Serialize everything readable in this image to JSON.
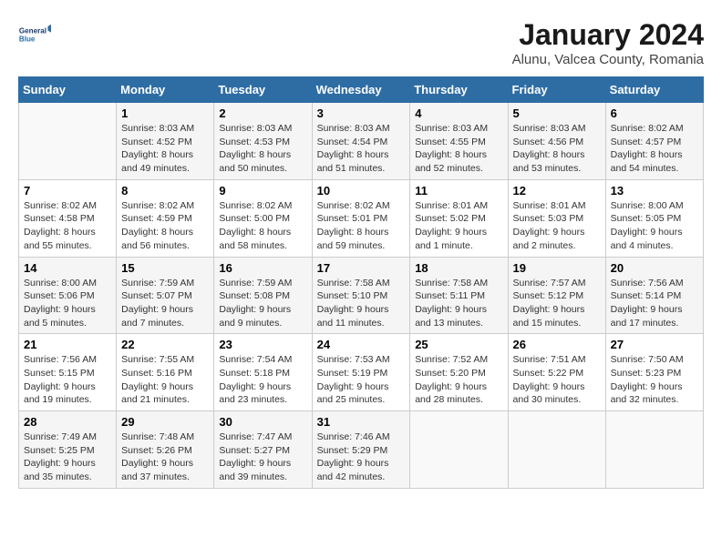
{
  "header": {
    "logo_line1": "General",
    "logo_line2": "Blue",
    "month": "January 2024",
    "location": "Alunu, Valcea County, Romania"
  },
  "days_of_week": [
    "Sunday",
    "Monday",
    "Tuesday",
    "Wednesday",
    "Thursday",
    "Friday",
    "Saturday"
  ],
  "weeks": [
    [
      {
        "day": "",
        "sunrise": "",
        "sunset": "",
        "daylight": ""
      },
      {
        "day": "1",
        "sunrise": "Sunrise: 8:03 AM",
        "sunset": "Sunset: 4:52 PM",
        "daylight": "Daylight: 8 hours and 49 minutes."
      },
      {
        "day": "2",
        "sunrise": "Sunrise: 8:03 AM",
        "sunset": "Sunset: 4:53 PM",
        "daylight": "Daylight: 8 hours and 50 minutes."
      },
      {
        "day": "3",
        "sunrise": "Sunrise: 8:03 AM",
        "sunset": "Sunset: 4:54 PM",
        "daylight": "Daylight: 8 hours and 51 minutes."
      },
      {
        "day": "4",
        "sunrise": "Sunrise: 8:03 AM",
        "sunset": "Sunset: 4:55 PM",
        "daylight": "Daylight: 8 hours and 52 minutes."
      },
      {
        "day": "5",
        "sunrise": "Sunrise: 8:03 AM",
        "sunset": "Sunset: 4:56 PM",
        "daylight": "Daylight: 8 hours and 53 minutes."
      },
      {
        "day": "6",
        "sunrise": "Sunrise: 8:02 AM",
        "sunset": "Sunset: 4:57 PM",
        "daylight": "Daylight: 8 hours and 54 minutes."
      }
    ],
    [
      {
        "day": "7",
        "sunrise": "Sunrise: 8:02 AM",
        "sunset": "Sunset: 4:58 PM",
        "daylight": "Daylight: 8 hours and 55 minutes."
      },
      {
        "day": "8",
        "sunrise": "Sunrise: 8:02 AM",
        "sunset": "Sunset: 4:59 PM",
        "daylight": "Daylight: 8 hours and 56 minutes."
      },
      {
        "day": "9",
        "sunrise": "Sunrise: 8:02 AM",
        "sunset": "Sunset: 5:00 PM",
        "daylight": "Daylight: 8 hours and 58 minutes."
      },
      {
        "day": "10",
        "sunrise": "Sunrise: 8:02 AM",
        "sunset": "Sunset: 5:01 PM",
        "daylight": "Daylight: 8 hours and 59 minutes."
      },
      {
        "day": "11",
        "sunrise": "Sunrise: 8:01 AM",
        "sunset": "Sunset: 5:02 PM",
        "daylight": "Daylight: 9 hours and 1 minute."
      },
      {
        "day": "12",
        "sunrise": "Sunrise: 8:01 AM",
        "sunset": "Sunset: 5:03 PM",
        "daylight": "Daylight: 9 hours and 2 minutes."
      },
      {
        "day": "13",
        "sunrise": "Sunrise: 8:00 AM",
        "sunset": "Sunset: 5:05 PM",
        "daylight": "Daylight: 9 hours and 4 minutes."
      }
    ],
    [
      {
        "day": "14",
        "sunrise": "Sunrise: 8:00 AM",
        "sunset": "Sunset: 5:06 PM",
        "daylight": "Daylight: 9 hours and 5 minutes."
      },
      {
        "day": "15",
        "sunrise": "Sunrise: 7:59 AM",
        "sunset": "Sunset: 5:07 PM",
        "daylight": "Daylight: 9 hours and 7 minutes."
      },
      {
        "day": "16",
        "sunrise": "Sunrise: 7:59 AM",
        "sunset": "Sunset: 5:08 PM",
        "daylight": "Daylight: 9 hours and 9 minutes."
      },
      {
        "day": "17",
        "sunrise": "Sunrise: 7:58 AM",
        "sunset": "Sunset: 5:10 PM",
        "daylight": "Daylight: 9 hours and 11 minutes."
      },
      {
        "day": "18",
        "sunrise": "Sunrise: 7:58 AM",
        "sunset": "Sunset: 5:11 PM",
        "daylight": "Daylight: 9 hours and 13 minutes."
      },
      {
        "day": "19",
        "sunrise": "Sunrise: 7:57 AM",
        "sunset": "Sunset: 5:12 PM",
        "daylight": "Daylight: 9 hours and 15 minutes."
      },
      {
        "day": "20",
        "sunrise": "Sunrise: 7:56 AM",
        "sunset": "Sunset: 5:14 PM",
        "daylight": "Daylight: 9 hours and 17 minutes."
      }
    ],
    [
      {
        "day": "21",
        "sunrise": "Sunrise: 7:56 AM",
        "sunset": "Sunset: 5:15 PM",
        "daylight": "Daylight: 9 hours and 19 minutes."
      },
      {
        "day": "22",
        "sunrise": "Sunrise: 7:55 AM",
        "sunset": "Sunset: 5:16 PM",
        "daylight": "Daylight: 9 hours and 21 minutes."
      },
      {
        "day": "23",
        "sunrise": "Sunrise: 7:54 AM",
        "sunset": "Sunset: 5:18 PM",
        "daylight": "Daylight: 9 hours and 23 minutes."
      },
      {
        "day": "24",
        "sunrise": "Sunrise: 7:53 AM",
        "sunset": "Sunset: 5:19 PM",
        "daylight": "Daylight: 9 hours and 25 minutes."
      },
      {
        "day": "25",
        "sunrise": "Sunrise: 7:52 AM",
        "sunset": "Sunset: 5:20 PM",
        "daylight": "Daylight: 9 hours and 28 minutes."
      },
      {
        "day": "26",
        "sunrise": "Sunrise: 7:51 AM",
        "sunset": "Sunset: 5:22 PM",
        "daylight": "Daylight: 9 hours and 30 minutes."
      },
      {
        "day": "27",
        "sunrise": "Sunrise: 7:50 AM",
        "sunset": "Sunset: 5:23 PM",
        "daylight": "Daylight: 9 hours and 32 minutes."
      }
    ],
    [
      {
        "day": "28",
        "sunrise": "Sunrise: 7:49 AM",
        "sunset": "Sunset: 5:25 PM",
        "daylight": "Daylight: 9 hours and 35 minutes."
      },
      {
        "day": "29",
        "sunrise": "Sunrise: 7:48 AM",
        "sunset": "Sunset: 5:26 PM",
        "daylight": "Daylight: 9 hours and 37 minutes."
      },
      {
        "day": "30",
        "sunrise": "Sunrise: 7:47 AM",
        "sunset": "Sunset: 5:27 PM",
        "daylight": "Daylight: 9 hours and 39 minutes."
      },
      {
        "day": "31",
        "sunrise": "Sunrise: 7:46 AM",
        "sunset": "Sunset: 5:29 PM",
        "daylight": "Daylight: 9 hours and 42 minutes."
      },
      {
        "day": "",
        "sunrise": "",
        "sunset": "",
        "daylight": ""
      },
      {
        "day": "",
        "sunrise": "",
        "sunset": "",
        "daylight": ""
      },
      {
        "day": "",
        "sunrise": "",
        "sunset": "",
        "daylight": ""
      }
    ]
  ]
}
